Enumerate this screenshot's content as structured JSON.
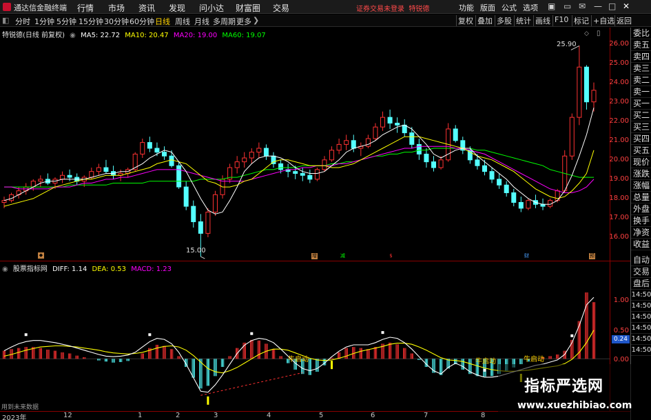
{
  "menubar": {
    "app_title": "通达信金融终端",
    "menus": [
      "行情",
      "市场",
      "资讯",
      "发现",
      "问小达",
      "财富圈",
      "交易"
    ],
    "notice": "证券交易未登录",
    "notice_stock": "特锐德",
    "right_menus": [
      "功能",
      "版面",
      "公式",
      "选项"
    ],
    "window_buttons": [
      "▣",
      "▭",
      "✉",
      "—",
      "□",
      "✕"
    ]
  },
  "toolbar": {
    "periods": [
      "分时",
      "1分钟",
      "5分钟",
      "15分钟",
      "30分钟",
      "60分钟",
      "日线",
      "周线",
      "月线",
      "多周期",
      "更多"
    ],
    "selected_period": "日线",
    "right_tools": [
      "复权",
      "叠加",
      "多股",
      "统计",
      "画线",
      "F10",
      "标记",
      "+自选",
      "返回"
    ]
  },
  "price_legend": {
    "stock_name": "特锐德(日线 前复权)",
    "ma5": "MA5: 22.72",
    "ma10": "MA10: 20.47",
    "ma20": "MA20: 19.00",
    "ma60": "MA60: 19.07",
    "colors": {
      "ma5": "#ffffff",
      "ma10": "#ffff00",
      "ma20": "#ff00ff",
      "ma60": "#00ff00"
    }
  },
  "price_axis": {
    "ticks": [
      "26.00",
      "25.00",
      "24.00",
      "23.00",
      "22.00",
      "21.00",
      "20.00",
      "19.00",
      "18.00",
      "17.00",
      "16.00"
    ],
    "high_label": "25.90",
    "low_label": "15.00"
  },
  "indicator_legend": {
    "name": "股票指标网",
    "diff": "DIFF: 1.14",
    "dea": "DEA: 0.53",
    "macd": "MACD: 1.23"
  },
  "indicator_axis": {
    "ticks": [
      "1.00",
      "0.50",
      "0.00"
    ],
    "badge": "0.24"
  },
  "markers": {
    "signals": [
      "牛启动",
      "牛启动",
      "牛启动"
    ],
    "event_labels": [
      "增",
      "减",
      "$",
      "财",
      "预"
    ]
  },
  "date_axis": {
    "labels": [
      "2023年",
      "12",
      "1",
      "2",
      "3",
      "4",
      "5",
      "6",
      "7",
      "8"
    ]
  },
  "corner_note": "用到未来数据",
  "side_panel": {
    "items": [
      "委比",
      "卖五",
      "卖四",
      "卖三",
      "卖二",
      "卖一",
      "买一",
      "买二",
      "买三",
      "买四",
      "买五",
      "现价",
      "涨跌",
      "涨幅",
      "总量",
      "外盘",
      "换手",
      "净资",
      "收益"
    ],
    "lower_items": [
      "自动",
      "交易",
      "盘后"
    ],
    "times": [
      "14:50",
      "14:50",
      "14:50",
      "14:50",
      "14:50",
      "14:50"
    ]
  },
  "watermark": {
    "title": "指标严选网",
    "url": "www.xuezhibiao.com"
  },
  "chart_data": {
    "type": "candlestick",
    "price": {
      "ylim": [
        15.5,
        26.2
      ],
      "ohlc": [
        [
          17.8,
          18.1,
          17.5,
          17.9
        ],
        [
          17.9,
          18.3,
          17.8,
          18.2
        ],
        [
          18.2,
          18.6,
          18.0,
          18.4
        ],
        [
          18.4,
          18.8,
          18.2,
          18.6
        ],
        [
          18.6,
          19.0,
          18.4,
          18.9
        ],
        [
          18.9,
          19.2,
          18.6,
          19.0
        ],
        [
          19.0,
          19.3,
          18.7,
          18.8
        ],
        [
          18.8,
          19.1,
          18.5,
          19.0
        ],
        [
          19.0,
          19.4,
          18.8,
          19.2
        ],
        [
          19.2,
          19.5,
          18.9,
          19.1
        ],
        [
          19.1,
          19.3,
          18.7,
          18.9
        ],
        [
          18.9,
          19.2,
          18.6,
          19.1
        ],
        [
          19.1,
          19.6,
          19.0,
          19.4
        ],
        [
          19.4,
          19.8,
          19.2,
          19.6
        ],
        [
          19.6,
          20.0,
          19.3,
          19.4
        ],
        [
          19.4,
          19.7,
          19.0,
          19.2
        ],
        [
          19.2,
          19.5,
          18.9,
          19.3
        ],
        [
          19.3,
          19.6,
          19.1,
          19.5
        ],
        [
          19.5,
          20.4,
          19.4,
          20.3
        ],
        [
          20.3,
          21.1,
          20.1,
          20.9
        ],
        [
          20.9,
          21.2,
          20.4,
          20.6
        ],
        [
          20.6,
          20.9,
          20.2,
          20.4
        ],
        [
          20.4,
          20.7,
          20.0,
          20.2
        ],
        [
          20.2,
          20.5,
          19.6,
          19.7
        ],
        [
          19.7,
          19.9,
          18.5,
          18.6
        ],
        [
          18.6,
          18.9,
          17.4,
          17.6
        ],
        [
          17.6,
          17.9,
          16.5,
          16.8
        ],
        [
          16.8,
          17.2,
          15.0,
          16.2
        ],
        [
          16.2,
          17.5,
          16.0,
          17.3
        ],
        [
          17.3,
          18.4,
          17.1,
          18.2
        ],
        [
          18.2,
          19.2,
          18.0,
          19.0
        ],
        [
          19.0,
          19.8,
          18.8,
          19.6
        ],
        [
          19.6,
          20.2,
          19.3,
          19.9
        ],
        [
          19.9,
          20.4,
          19.6,
          20.1
        ],
        [
          20.1,
          20.6,
          19.8,
          20.4
        ],
        [
          20.4,
          20.9,
          20.1,
          20.6
        ],
        [
          20.6,
          20.8,
          20.0,
          20.2
        ],
        [
          20.2,
          20.4,
          19.6,
          19.8
        ],
        [
          19.8,
          20.0,
          19.3,
          19.5
        ],
        [
          19.5,
          19.8,
          19.1,
          19.4
        ],
        [
          19.4,
          19.7,
          19.0,
          19.3
        ],
        [
          19.3,
          19.6,
          18.9,
          19.2
        ],
        [
          19.2,
          19.5,
          18.8,
          19.0
        ],
        [
          19.0,
          19.6,
          18.9,
          19.5
        ],
        [
          19.5,
          20.2,
          19.4,
          20.0
        ],
        [
          20.0,
          20.7,
          19.9,
          20.5
        ],
        [
          20.5,
          21.1,
          20.3,
          20.8
        ],
        [
          20.8,
          21.3,
          20.5,
          21.0
        ],
        [
          21.0,
          21.3,
          20.4,
          20.6
        ],
        [
          20.6,
          20.9,
          20.2,
          20.7
        ],
        [
          20.7,
          21.3,
          20.6,
          21.1
        ],
        [
          21.1,
          21.9,
          21.0,
          21.7
        ],
        [
          21.7,
          22.5,
          21.5,
          22.2
        ],
        [
          22.2,
          22.6,
          21.6,
          21.9
        ],
        [
          21.9,
          22.2,
          21.4,
          21.8
        ],
        [
          21.8,
          22.1,
          21.2,
          21.4
        ],
        [
          21.4,
          21.7,
          20.6,
          20.8
        ],
        [
          20.8,
          21.1,
          20.0,
          20.3
        ],
        [
          20.3,
          20.6,
          19.6,
          19.9
        ],
        [
          19.9,
          20.2,
          19.4,
          19.6
        ],
        [
          19.6,
          20.2,
          19.5,
          20.0
        ],
        [
          20.0,
          21.9,
          19.9,
          21.6
        ],
        [
          21.6,
          21.8,
          20.9,
          21.0
        ],
        [
          21.0,
          21.2,
          20.3,
          20.5
        ],
        [
          20.5,
          20.7,
          19.8,
          20.0
        ],
        [
          20.0,
          20.3,
          19.5,
          19.7
        ],
        [
          19.7,
          20.0,
          19.2,
          19.4
        ],
        [
          19.4,
          19.6,
          18.8,
          19.0
        ],
        [
          19.0,
          19.3,
          18.5,
          18.7
        ],
        [
          18.7,
          18.9,
          18.1,
          18.3
        ],
        [
          18.3,
          18.5,
          17.6,
          17.8
        ],
        [
          17.8,
          18.1,
          17.3,
          17.5
        ],
        [
          17.5,
          18.0,
          17.4,
          17.9
        ],
        [
          17.9,
          18.2,
          17.5,
          17.7
        ],
        [
          17.7,
          18.0,
          17.4,
          17.6
        ],
        [
          17.6,
          18.0,
          17.5,
          17.9
        ],
        [
          17.9,
          18.5,
          17.8,
          18.4
        ],
        [
          18.4,
          20.5,
          18.3,
          20.2
        ],
        [
          20.2,
          22.4,
          20.0,
          22.2
        ],
        [
          22.2,
          25.9,
          21.8,
          24.8
        ],
        [
          24.8,
          24.9,
          22.6,
          23.0
        ],
        [
          23.0,
          24.0,
          22.5,
          23.6
        ]
      ],
      "ma5": [
        17.9,
        18.0,
        18.2,
        18.4,
        18.6,
        18.8,
        18.9,
        18.9,
        19.0,
        19.0,
        19.0,
        19.0,
        19.1,
        19.2,
        19.3,
        19.3,
        19.4,
        19.4,
        19.6,
        19.8,
        20.1,
        20.3,
        20.5,
        20.4,
        19.9,
        19.4,
        18.7,
        18.0,
        17.4,
        17.2,
        17.3,
        17.9,
        18.6,
        19.4,
        19.8,
        20.1,
        20.2,
        20.2,
        20.1,
        19.9,
        19.6,
        19.4,
        19.3,
        19.3,
        19.4,
        19.7,
        20.0,
        20.4,
        20.6,
        20.7,
        20.8,
        21.0,
        21.3,
        21.5,
        21.7,
        21.8,
        21.6,
        21.2,
        20.8,
        20.3,
        20.1,
        20.3,
        20.5,
        20.6,
        20.6,
        20.2,
        19.9,
        19.6,
        19.3,
        19.0,
        18.6,
        18.3,
        18.0,
        17.8,
        17.7,
        17.7,
        17.9,
        18.4,
        19.2,
        20.2,
        21.3,
        22.7
      ],
      "ma10": [
        17.6,
        17.7,
        17.8,
        17.9,
        18.0,
        18.2,
        18.4,
        18.6,
        18.7,
        18.8,
        18.9,
        19.0,
        19.0,
        19.1,
        19.2,
        19.2,
        19.2,
        19.3,
        19.4,
        19.5,
        19.6,
        19.8,
        19.9,
        20.0,
        19.9,
        19.8,
        19.5,
        19.2,
        18.9,
        18.8,
        18.6,
        18.6,
        18.7,
        18.9,
        19.0,
        19.3,
        19.6,
        19.9,
        20.0,
        20.0,
        19.9,
        19.8,
        19.7,
        19.7,
        19.7,
        19.6,
        19.6,
        19.7,
        19.8,
        20.0,
        20.2,
        20.4,
        20.6,
        20.8,
        21.0,
        21.2,
        21.2,
        21.2,
        21.1,
        21.0,
        20.9,
        20.8,
        20.7,
        20.6,
        20.4,
        20.2,
        20.1,
        20.0,
        19.8,
        19.6,
        19.4,
        19.1,
        18.8,
        18.5,
        18.3,
        18.1,
        18.0,
        18.1,
        18.4,
        18.8,
        19.3,
        20.5
      ],
      "ma20": [
        18.6,
        18.6,
        18.5,
        18.5,
        18.5,
        18.5,
        18.5,
        18.6,
        18.6,
        18.6,
        18.7,
        18.8,
        18.8,
        18.9,
        19.0,
        19.0,
        19.1,
        19.1,
        19.2,
        19.3,
        19.4,
        19.5,
        19.5,
        19.5,
        19.5,
        19.4,
        19.3,
        19.2,
        19.1,
        19.0,
        18.9,
        18.9,
        18.9,
        18.9,
        19.0,
        19.1,
        19.2,
        19.3,
        19.4,
        19.5,
        19.5,
        19.6,
        19.6,
        19.7,
        19.7,
        19.7,
        19.8,
        19.8,
        19.9,
        20.0,
        20.1,
        20.2,
        20.3,
        20.4,
        20.5,
        20.6,
        20.6,
        20.7,
        20.7,
        20.7,
        20.7,
        20.7,
        20.6,
        20.6,
        20.5,
        20.4,
        20.3,
        20.1,
        19.9,
        19.7,
        19.5,
        19.3,
        19.1,
        18.9,
        18.7,
        18.5,
        18.4,
        18.3,
        18.3,
        18.4,
        18.6,
        19.0
      ],
      "ma60": [
        18.6,
        18.6,
        18.6,
        18.6,
        18.6,
        18.6,
        18.6,
        18.6,
        18.6,
        18.7,
        18.7,
        18.7,
        18.7,
        18.7,
        18.7,
        18.8,
        18.8,
        18.8,
        18.8,
        18.8,
        18.9,
        18.9,
        18.9,
        18.9,
        18.9,
        18.9,
        18.9,
        19.0,
        19.0,
        19.0,
        19.0,
        19.1,
        19.1,
        19.2,
        19.3,
        19.4,
        19.5,
        19.5,
        19.6,
        19.6,
        19.6,
        19.7,
        19.7,
        19.7,
        19.7,
        19.8,
        19.8,
        19.9,
        19.9,
        20.0,
        20.1,
        20.2,
        20.2,
        20.3,
        20.3,
        20.4,
        20.4,
        20.5,
        20.5,
        20.6,
        20.6,
        20.6,
        20.6,
        20.6,
        20.6,
        20.5,
        20.5,
        20.4,
        20.3,
        20.2,
        20.1,
        20.0,
        19.9,
        19.8,
        19.7,
        19.5,
        19.4,
        19.3,
        19.2,
        19.1,
        19.1,
        19.1
      ]
    },
    "macd": {
      "ylim": [
        -0.75,
        1.55
      ],
      "hist": [
        0.15,
        0.18,
        0.2,
        0.22,
        0.22,
        0.2,
        0.17,
        0.15,
        0.12,
        0.1,
        0.06,
        0.03,
        0.0,
        -0.03,
        -0.05,
        -0.07,
        -0.06,
        -0.04,
        0.0,
        0.1,
        0.2,
        0.26,
        0.24,
        0.18,
        0.05,
        -0.15,
        -0.35,
        -0.55,
        -0.5,
        -0.32,
        -0.15,
        0.05,
        0.2,
        0.3,
        0.35,
        0.34,
        0.28,
        0.18,
        0.05,
        -0.08,
        -0.2,
        -0.28,
        -0.3,
        -0.24,
        -0.12,
        0.02,
        0.12,
        0.2,
        0.22,
        0.2,
        0.18,
        0.22,
        0.28,
        0.3,
        0.27,
        0.2,
        0.1,
        -0.02,
        -0.15,
        -0.26,
        -0.3,
        -0.18,
        -0.1,
        -0.2,
        -0.28,
        -0.32,
        -0.33,
        -0.32,
        -0.28,
        -0.22,
        -0.16,
        -0.1,
        -0.05,
        0.0,
        0.03,
        0.05,
        0.08,
        0.15,
        0.35,
        0.7,
        1.23,
        1.05
      ],
      "diff": [
        0.15,
        0.22,
        0.28,
        0.32,
        0.34,
        0.34,
        0.32,
        0.3,
        0.27,
        0.24,
        0.2,
        0.16,
        0.12,
        0.08,
        0.05,
        0.04,
        0.05,
        0.07,
        0.12,
        0.22,
        0.32,
        0.38,
        0.36,
        0.28,
        0.12,
        -0.1,
        -0.35,
        -0.6,
        -0.62,
        -0.48,
        -0.3,
        -0.1,
        0.1,
        0.25,
        0.34,
        0.38,
        0.36,
        0.3,
        0.18,
        0.05,
        -0.08,
        -0.18,
        -0.22,
        -0.18,
        -0.08,
        0.04,
        0.14,
        0.22,
        0.26,
        0.26,
        0.26,
        0.3,
        0.36,
        0.4,
        0.38,
        0.3,
        0.18,
        0.04,
        -0.1,
        -0.22,
        -0.28,
        -0.16,
        -0.08,
        -0.14,
        -0.24,
        -0.3,
        -0.34,
        -0.34,
        -0.32,
        -0.28,
        -0.24,
        -0.2,
        -0.16,
        -0.12,
        -0.1,
        -0.06,
        -0.02,
        0.08,
        0.3,
        0.62,
        1.0,
        1.14
      ],
      "dea": [
        0.05,
        0.08,
        0.12,
        0.16,
        0.19,
        0.22,
        0.23,
        0.24,
        0.24,
        0.23,
        0.22,
        0.2,
        0.18,
        0.16,
        0.13,
        0.11,
        0.1,
        0.09,
        0.1,
        0.12,
        0.16,
        0.2,
        0.23,
        0.24,
        0.22,
        0.16,
        0.06,
        -0.06,
        -0.18,
        -0.24,
        -0.26,
        -0.22,
        -0.16,
        -0.08,
        0.0,
        0.08,
        0.14,
        0.18,
        0.18,
        0.16,
        0.11,
        0.06,
        0.01,
        -0.02,
        -0.03,
        -0.02,
        0.01,
        0.05,
        0.1,
        0.14,
        0.17,
        0.2,
        0.23,
        0.27,
        0.29,
        0.29,
        0.27,
        0.22,
        0.16,
        0.09,
        0.02,
        -0.02,
        -0.03,
        -0.05,
        -0.09,
        -0.13,
        -0.17,
        -0.2,
        -0.22,
        -0.23,
        -0.23,
        -0.22,
        -0.21,
        -0.19,
        -0.17,
        -0.15,
        -0.13,
        -0.09,
        -0.01,
        0.12,
        0.3,
        0.53
      ]
    }
  }
}
